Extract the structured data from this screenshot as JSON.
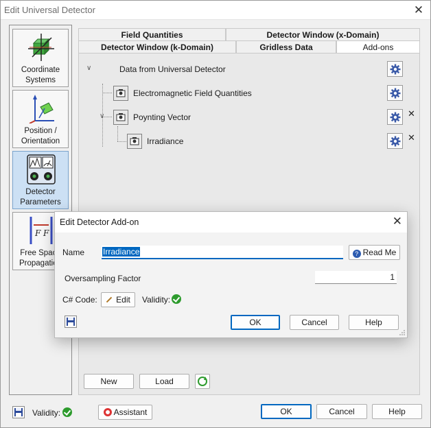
{
  "window": {
    "title": "Edit Universal Detector",
    "close_glyph": "✕"
  },
  "nav": [
    {
      "label": "Coordinate Systems",
      "icon": "coordinate-systems-icon"
    },
    {
      "label": "Position / Orientation",
      "icon": "position-orientation-icon"
    },
    {
      "label": "Detector Parameters",
      "icon": "detector-parameters-icon"
    },
    {
      "label": "Free Space Propagation",
      "icon": "free-space-propagation-icon"
    }
  ],
  "tabs": {
    "row1": [
      "Field Quantities",
      "Detector Window (x-Domain)"
    ],
    "row2": [
      "Detector Window (k-Domain)",
      "Gridless Data",
      "Add-ons"
    ],
    "active": "Add-ons"
  },
  "tree": {
    "root": "Data from Universal Detector",
    "items": [
      {
        "label": "Electromagnetic Field Quantities",
        "removable": false
      },
      {
        "label": "Poynting Vector",
        "removable": true
      },
      {
        "label": "Irradiance",
        "removable": true
      }
    ],
    "remove_glyph": "✕"
  },
  "panel_buttons": {
    "new": "New",
    "load": "Load"
  },
  "bottom": {
    "validity_label": "Validity:",
    "assistant": "Assistant",
    "ok": "OK",
    "cancel": "Cancel",
    "help": "Help"
  },
  "dialog": {
    "title": "Edit Detector Add-on",
    "close_glyph": "✕",
    "name_label": "Name",
    "name_value": "Irradiance",
    "read_me": "Read Me",
    "oversampling_label": "Oversampling Factor",
    "oversampling_value": "1",
    "code_label": "C# Code:",
    "edit": "Edit",
    "validity_label": "Validity:",
    "ok": "OK",
    "cancel": "Cancel",
    "help": "Help"
  },
  "colors": {
    "accent": "#0067c0",
    "active_nav": "#cce0f4",
    "valid_green": "#2d9b2d"
  }
}
